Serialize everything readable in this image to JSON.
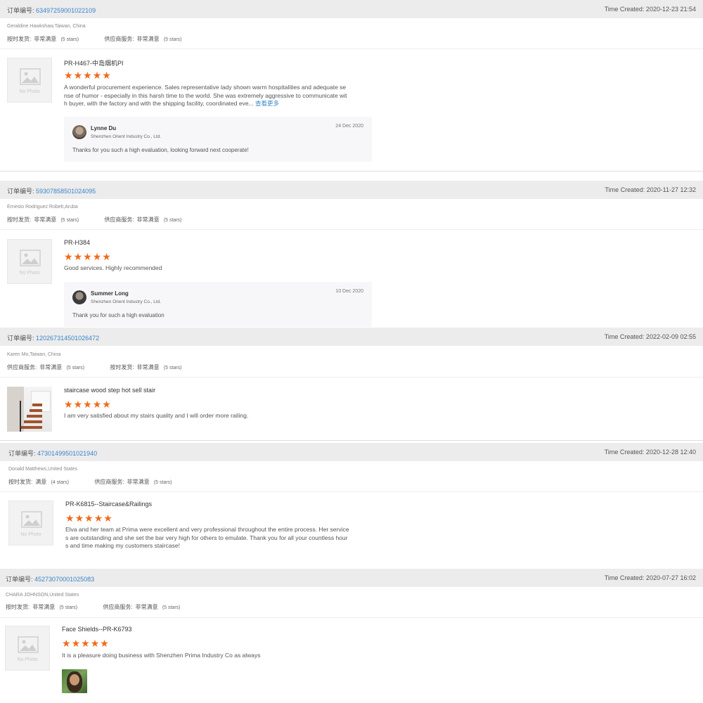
{
  "orders": [
    {
      "order_label": "订单编号:",
      "order_no": "63497259001022109",
      "time_created": "Time Created: 2020-12-23 21:54",
      "buyer": "Geraldine Hawkshaw,Taiwan, China",
      "ratings": [
        {
          "label": "按时发货:",
          "value": "非常满意",
          "stars": "(5 stars)"
        },
        {
          "label": "供应商服务:",
          "value": "非常满意",
          "stars": "(5 stars)"
        }
      ],
      "product": "PR-H467-中岛烟机PI",
      "photo": "No Photo",
      "rating_stars": 5,
      "review": "A wonderful procurement experience. Sales representative lady shown warm hospitalities and adequate sense of humor - especially in this harsh time to the world. She was extremely aggressive to communicate with buyer, with the factory and with the shipping facility, coordinated eve...",
      "review_lines": [
        "A wonderful procurement experience. Sales representative lady shown warm hospitalities and adequate se",
        "nse of humor - especially in this harsh time to the world. She was extremely aggressive to communicate wit",
        "h buyer, with the factory and with the shipping facility, coordinated eve..."
      ],
      "see_more": "查看更多",
      "reply": {
        "name": "Lynne Du",
        "company": "Shenzhen Orient Industry Co., Ltd.",
        "date": "24 Dec 2020",
        "text": "Thanks for you such a high evaluation, looking forward next cooperate!"
      }
    },
    {
      "order_label": "订单编号:",
      "order_no": "59307858501024095",
      "time_created": "Time Created: 2020-11-27 12:32",
      "buyer": "Ernesto Rodriguez Robelt,Aruba",
      "ratings": [
        {
          "label": "按时发货:",
          "value": "非常满意",
          "stars": "(5 stars)"
        },
        {
          "label": "供应商服务:",
          "value": "非常满意",
          "stars": "(5 stars)"
        }
      ],
      "product": "PR-H384",
      "photo": "No Photo",
      "rating_stars": 5,
      "review_lines": [
        "Good services. Highly recommended"
      ],
      "reply": {
        "name": "Summer Long",
        "company": "Shenzhen Orient Industry Co., Ltd.",
        "date": "10 Dec 2020",
        "text": "Thank you for such a high evaluation"
      }
    },
    {
      "order_label": "订单编号:",
      "order_no": "120267314501026472",
      "time_created": "Time Created: 2022-02-09 02:55",
      "buyer": "Karen Mo,Taiwan, China",
      "ratings": [
        {
          "label": "供应商服务:",
          "value": "非常满意",
          "stars": "(5 stars)"
        },
        {
          "label": "按时发货:",
          "value": "非常满意",
          "stars": "(5 stars)"
        }
      ],
      "product": "staircase wood step hot sell stair",
      "rating_stars": 5,
      "review_lines": [
        "I am very satisfied about my stairs quality and I will order more railing."
      ]
    },
    {
      "order_label": "订单编号:",
      "order_no": "47301499501021940",
      "time_created": "Time Created: 2020-12-28 12:40",
      "buyer": "Donald Matthews,United States",
      "ratings": [
        {
          "label": "按时发货:",
          "value": "满意",
          "stars": "(4 stars)"
        },
        {
          "label": "供应商服务:",
          "value": "非常满意",
          "stars": "(5 stars)"
        }
      ],
      "product": "PR-K6815--Staircase&Railings",
      "photo": "No Photo",
      "rating_stars": 5,
      "review_lines": [
        "Elva and her team at Prima were excellent and very professional throughout the entire process. Her service",
        "s are outstanding and she set the bar very high for others to emulate. Thank you for all your countless hour",
        "s and time making my customers staircase!"
      ]
    },
    {
      "order_label": "订单编号:",
      "order_no": "45273070001025083",
      "time_created": "Time Created: 2020-07-27 16:02",
      "buyer": "CHARA JOHNSON,United States",
      "ratings": [
        {
          "label": "按时发货:",
          "value": "非常满意",
          "stars": "(5 stars)"
        },
        {
          "label": "供应商服务:",
          "value": "非常满意",
          "stars": "(5 stars)"
        }
      ],
      "product": "Face Shields--PR-K6793",
      "photo": "No Photo",
      "rating_stars": 5,
      "review_lines": [
        "It is a pleasure doing business with Shenzhen Prima Industry Co as always"
      ]
    }
  ],
  "colors": {
    "accent": "#3a86c8",
    "star": "#f06a1a",
    "header_bg": "#ececec"
  },
  "icons": {
    "no_photo": "image-placeholder-icon",
    "star": "star-icon"
  }
}
